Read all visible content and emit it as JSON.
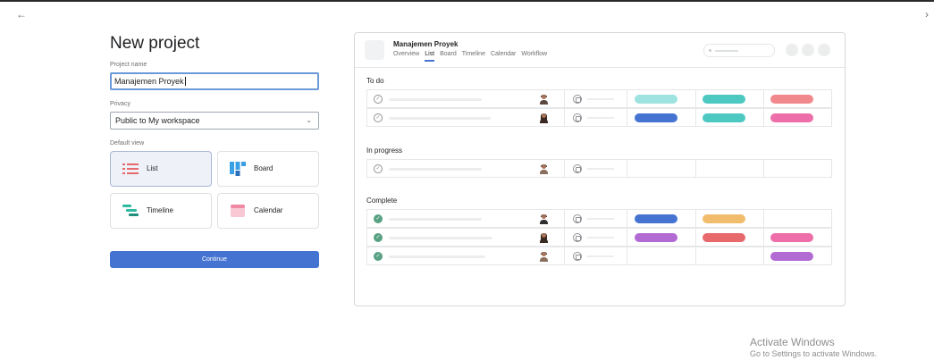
{
  "nav": {
    "back": "←",
    "forward": "›"
  },
  "form": {
    "title": "New project",
    "project_name_label": "Project name",
    "project_name_value": "Manajemen Proyek",
    "privacy_label": "Privacy",
    "privacy_value": "Public to My workspace",
    "default_view_label": "Default view",
    "views": [
      {
        "label": "List",
        "icon": "list-icon",
        "selected": true
      },
      {
        "label": "Board",
        "icon": "board-icon",
        "selected": false
      },
      {
        "label": "Timeline",
        "icon": "timeline-icon",
        "selected": false
      },
      {
        "label": "Calendar",
        "icon": "calendar-icon",
        "selected": false
      }
    ],
    "continue_label": "Continue"
  },
  "preview": {
    "project_name": "Manajemen Proyek",
    "tabs": [
      "Overview",
      "List",
      "Board",
      "Timeline",
      "Calendar",
      "Workflow"
    ],
    "active_tab": "List",
    "sections": [
      {
        "name": "To do"
      },
      {
        "name": "In progress"
      },
      {
        "name": "Complete"
      }
    ]
  },
  "colors": {
    "accent": "#4573d2",
    "teal_light": "#9ee3e0",
    "teal": "#4ec9c2",
    "salmon": "#f1898c",
    "blue": "#4573d2",
    "pink": "#ed6ea8",
    "orange": "#f1bd6c",
    "purple": "#b36bd4",
    "red": "#e8696b",
    "done_green": "#58a182"
  },
  "watermark": {
    "line1": "Activate Windows",
    "line2": "Go to Settings to activate Windows."
  }
}
